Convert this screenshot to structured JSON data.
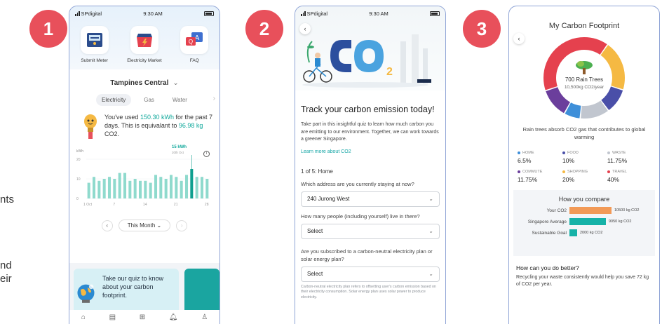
{
  "partial_text": {
    "line1": "nts",
    "line2": "nd",
    "line3": "eir"
  },
  "steps": [
    "1",
    "2",
    "3"
  ],
  "phone1": {
    "status": {
      "carrier": "SPdigital",
      "time": "9:30 AM"
    },
    "services": [
      {
        "label": "Submit Meter",
        "icon": "meter-icon"
      },
      {
        "label": "Electricity Market",
        "icon": "electricity-market-icon"
      },
      {
        "label": "FAQ",
        "icon": "faq-icon"
      }
    ],
    "location": "Tampines Central",
    "tabs": [
      "Electricity",
      "Gas",
      "Water"
    ],
    "active_tab": "Electricity",
    "usage": {
      "p1": "You've used ",
      "kwh": "150.30 kWh",
      "p2": " for the past 7 days. This is equivalant to ",
      "co2": "96.98 kg",
      "p3": " CO2."
    },
    "chart_data": {
      "type": "bar",
      "ylabel": "kWh",
      "yticks": [
        "20",
        "10",
        "0"
      ],
      "xticks": [
        "1 Oct",
        "7",
        "14",
        "21",
        "28"
      ],
      "tooltip": {
        "value": "15",
        "unit": "kWh",
        "date": "20th Oct"
      },
      "values": [
        8,
        11,
        9,
        10,
        11,
        10,
        13,
        13,
        9,
        10,
        9,
        9,
        8,
        12,
        11,
        10,
        12,
        11,
        9,
        12,
        15,
        11,
        11,
        10
      ],
      "highlight_index": 20,
      "ylim": [
        0,
        20
      ]
    },
    "period": "This Month",
    "quiz_card": "Take our quiz to know about your carbon footprint.",
    "nav": [
      "home-icon",
      "bill-icon",
      "apps-icon",
      "notification-icon",
      "profile-icon"
    ]
  },
  "phone2": {
    "status": {
      "carrier": "SPdigital",
      "time": "9:30 AM"
    },
    "title": "Track your carbon emission today!",
    "intro": "Take part in this insightful quiz to learn how much carbon you are emitting to our environment. Together, we can work towards a greener Singapore.",
    "link": "Learn more about CO2",
    "progress": "1 of 5: Home",
    "q1": "Which address are you currently staying at now?",
    "a1": "240 Jurong West",
    "q2": "How many people (including yourself) live in there?",
    "a2": "Select",
    "q3": "Are you subscribed to a carbon-neutral electricity plan or solar energy plan?",
    "a3": "Select",
    "note": "Carbon-neutral electricity plan refers to offsetting user's carbon emission based on their electricity consumption. Solar energy plan uses solar power to produce electricity."
  },
  "phone3": {
    "title": "My Carbon Footprint",
    "donut": {
      "big": "700 Rain Trees",
      "small": "10,500kg CO2/year"
    },
    "absorb": "Rain trees absorb CO2 gas that contributes to global warming",
    "categories": [
      {
        "label": "HOME",
        "value": "6.5%",
        "color": "#3e8fd9"
      },
      {
        "label": "FOOD",
        "value": "10%",
        "color": "#4a4fa8"
      },
      {
        "label": "WASTE",
        "value": "11.75%",
        "color": "#c1c6cf"
      },
      {
        "label": "COMMUTE",
        "value": "11.75%",
        "color": "#6b3e9c"
      },
      {
        "label": "SHOPPING",
        "value": "20%",
        "color": "#f5b943"
      },
      {
        "label": "TRAVEL",
        "value": "40%",
        "color": "#e5414e"
      }
    ],
    "compare_title": "How you compare",
    "compare": [
      {
        "label": "Your CO2",
        "value": 10500,
        "text": "10500 kg CO2",
        "color": "#f29a57"
      },
      {
        "label": "Singapore Average",
        "value": 9050,
        "text": "9050 kg CO2",
        "color": "#16b2a8"
      },
      {
        "label": "Sustainable Goal",
        "value": 2000,
        "text": "2000 kg CO2",
        "color": "#16b2a8"
      }
    ],
    "better_title": "How can you do better?",
    "better_text": "Recycling your waste consistently would help you save 72 kg of CO2 per year."
  }
}
